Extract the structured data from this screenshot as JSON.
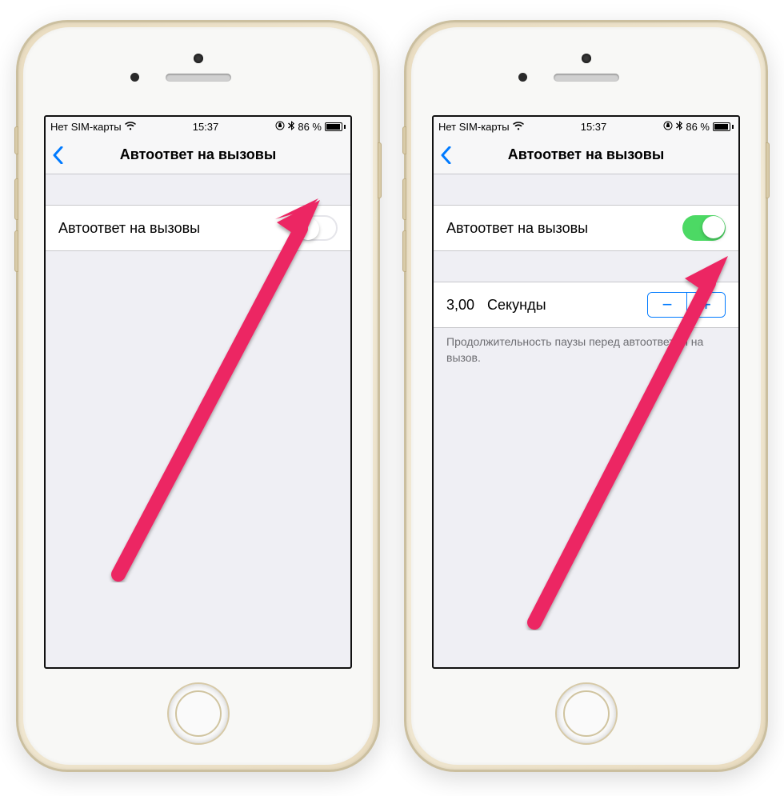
{
  "left": {
    "status": {
      "carrier": "Нет SIM-карты",
      "time": "15:37",
      "battery": "86 %"
    },
    "nav": {
      "title": "Автоответ на вызовы"
    },
    "row_toggle": {
      "label": "Автоответ на вызовы",
      "on": false
    }
  },
  "right": {
    "status": {
      "carrier": "Нет SIM-карты",
      "time": "15:37",
      "battery": "86 %"
    },
    "nav": {
      "title": "Автоответ на вызовы"
    },
    "row_toggle": {
      "label": "Автоответ на вызовы",
      "on": true
    },
    "seconds": {
      "value": "3,00",
      "unit": "Секунды"
    },
    "footer": "Продолжительность паузы перед автоответом на вызов."
  },
  "colors": {
    "accent": "#007aff",
    "toggle_on": "#4cd964",
    "arrow": "#ec2864"
  }
}
